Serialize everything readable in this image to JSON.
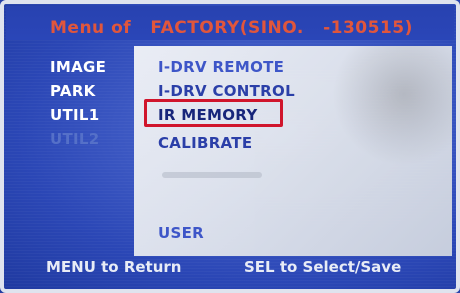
{
  "header": {
    "title": "Menu of   FACTORY(SINO.   -130515)"
  },
  "left_menu": {
    "items": [
      {
        "label": "IMAGE"
      },
      {
        "label": "PARK"
      },
      {
        "label": "UTIL1"
      },
      {
        "label": "UTIL2"
      }
    ]
  },
  "submenu": {
    "items": [
      {
        "label": "I-DRV REMOTE"
      },
      {
        "label": "I-DRV CONTROL"
      },
      {
        "label": "IR MEMORY"
      },
      {
        "label": "CALIBRATE"
      },
      {
        "label": "USER"
      }
    ],
    "selected": "IR MEMORY"
  },
  "footer": {
    "left": "MENU to Return",
    "right": "SEL to Select/Save"
  },
  "colors": {
    "background_blue": "#2b47b6",
    "header_text": "#e1563c",
    "menu_text": "#2b3fa8",
    "selection_box": "#d0152c"
  }
}
